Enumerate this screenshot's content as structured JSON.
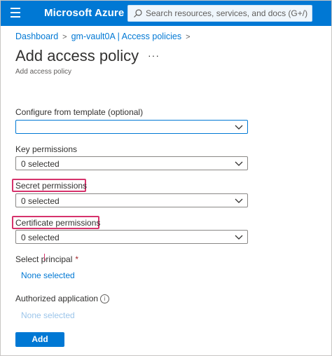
{
  "header": {
    "brand": "Microsoft Azure",
    "search_placeholder": "Search resources, services, and docs (G+/)"
  },
  "breadcrumb": {
    "items": [
      "Dashboard",
      "gm-vault0A | Access policies"
    ]
  },
  "page": {
    "title": "Add access policy",
    "more": "···",
    "subtitle": "Add access policy"
  },
  "form": {
    "template": {
      "label": "Configure from template (optional)",
      "value": ""
    },
    "key": {
      "label": "Key permissions",
      "value": "0 selected"
    },
    "secret": {
      "label": "Secret permissions",
      "value": "0 selected"
    },
    "certificate": {
      "label": "Certificate permissions",
      "value": "0 selected"
    },
    "principal": {
      "label": "Select principal",
      "required": "*",
      "value": "None selected"
    },
    "authorized": {
      "label": "Authorized application",
      "info": "i",
      "value": "None selected"
    },
    "add_label": "Add"
  },
  "colors": {
    "accent": "#0078d4",
    "highlight": "#d6336c"
  },
  "icons": [
    "hamburger-menu-icon",
    "search-icon",
    "chevron-right-icon",
    "chevron-down-icon",
    "info-icon"
  ]
}
